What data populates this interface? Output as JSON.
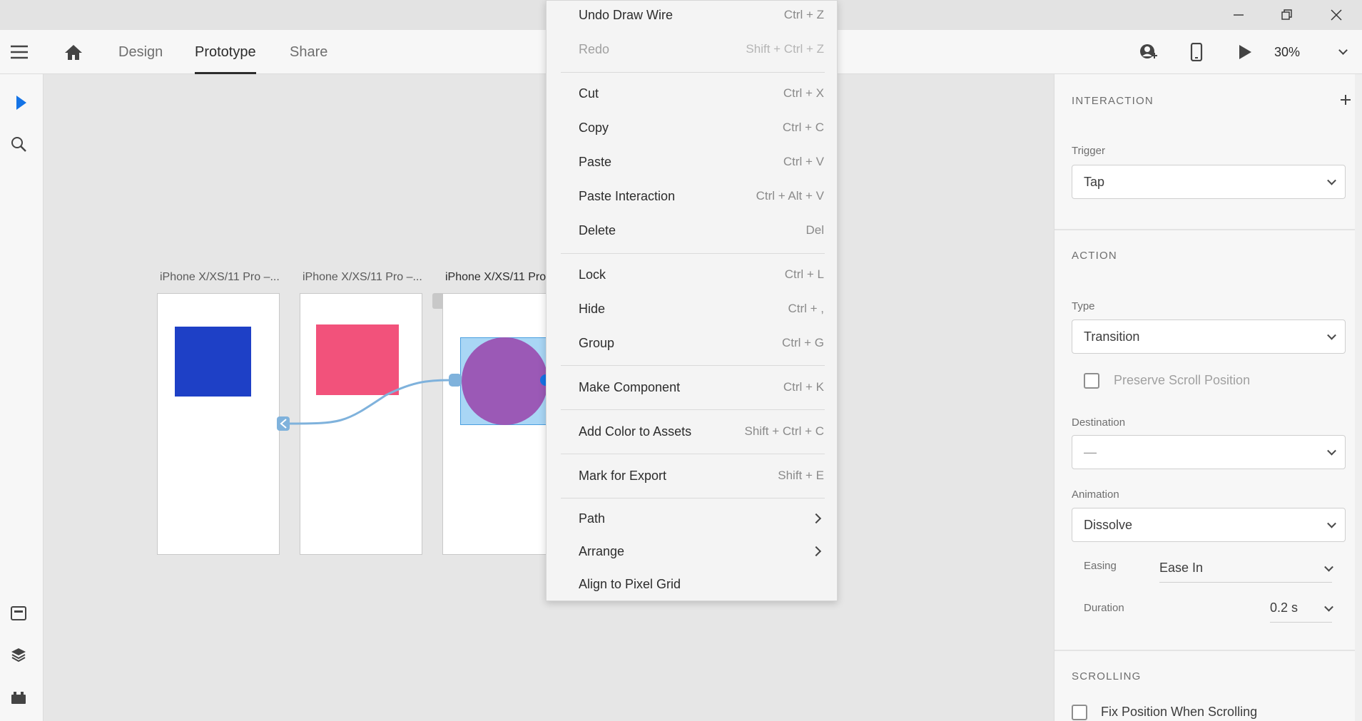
{
  "toolbar": {
    "tabs": [
      {
        "label": "Design"
      },
      {
        "label": "Prototype"
      },
      {
        "label": "Share"
      }
    ],
    "zoom": "30%"
  },
  "artboards": [
    {
      "label": "iPhone X/XS/11 Pro –..."
    },
    {
      "label": "iPhone X/XS/11 Pro –..."
    },
    {
      "label": "iPhone X/XS/11 Pro"
    }
  ],
  "context_menu": {
    "items": [
      {
        "label": "Undo Draw Wire",
        "shortcut": "Ctrl + Z"
      },
      {
        "label": "Redo",
        "shortcut": "Shift + Ctrl + Z"
      },
      {
        "label": "Cut",
        "shortcut": "Ctrl + X"
      },
      {
        "label": "Copy",
        "shortcut": "Ctrl + C"
      },
      {
        "label": "Paste",
        "shortcut": "Ctrl + V"
      },
      {
        "label": "Paste Interaction",
        "shortcut": "Ctrl + Alt + V"
      },
      {
        "label": "Delete",
        "shortcut": "Del"
      },
      {
        "label": "Lock",
        "shortcut": "Ctrl + L"
      },
      {
        "label": "Hide",
        "shortcut": "Ctrl + ,"
      },
      {
        "label": "Group",
        "shortcut": "Ctrl + G"
      },
      {
        "label": "Make Component",
        "shortcut": "Ctrl + K"
      },
      {
        "label": "Add Color to Assets",
        "shortcut": "Shift + Ctrl + C"
      },
      {
        "label": "Mark for Export",
        "shortcut": "Shift + E"
      },
      {
        "label": "Path"
      },
      {
        "label": "Arrange"
      },
      {
        "label": "Align to Pixel Grid"
      }
    ]
  },
  "panel": {
    "interaction": {
      "title": "INTERACTION",
      "trigger_label": "Trigger",
      "trigger_value": "Tap"
    },
    "action": {
      "title": "ACTION",
      "type_label": "Type",
      "type_value": "Transition",
      "preserve_scroll_label": "Preserve Scroll Position",
      "destination_label": "Destination",
      "destination_value": "—",
      "animation_label": "Animation",
      "animation_value": "Dissolve",
      "easing_label": "Easing",
      "easing_value": "Ease In",
      "duration_label": "Duration",
      "duration_value": "0.2 s"
    },
    "scrolling": {
      "title": "SCROLLING",
      "fix_position_label": "Fix Position When Scrolling"
    }
  },
  "colors": {
    "accent": "#1473e6",
    "wire": "#7fb2dc",
    "blue_rect": "#1e40c6",
    "pink_rect": "#f2527b",
    "circle": "#9b59b6",
    "selection": "#a9d6f5"
  }
}
